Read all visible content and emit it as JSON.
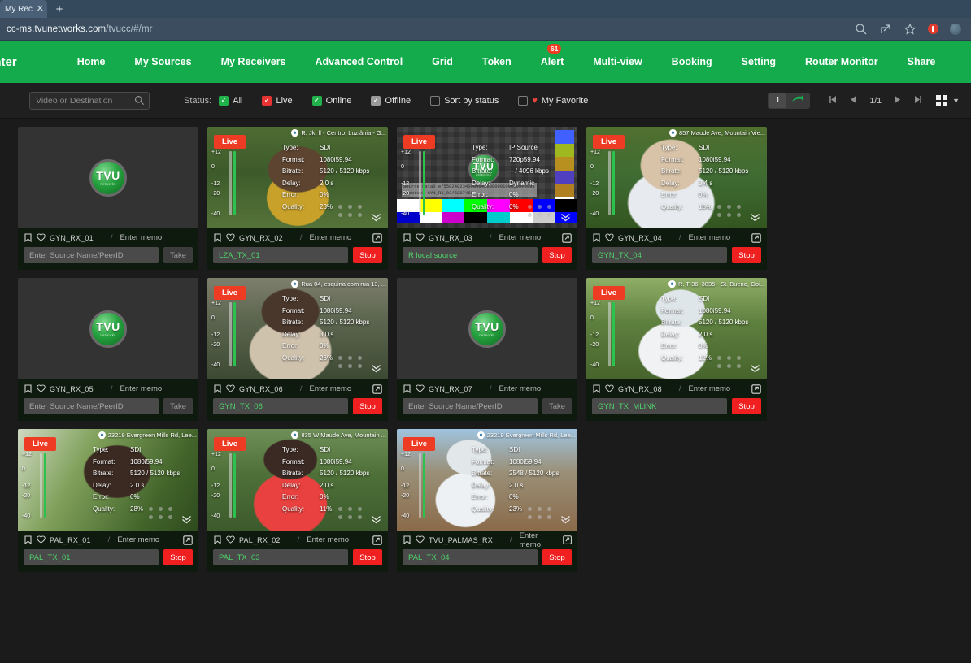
{
  "browser": {
    "tab_title": "My Rece",
    "tab_close": "✕",
    "new_tab": "+",
    "url_main": "cc-ms.tvunetworks.com",
    "url_path": "/tvucc/#/mr"
  },
  "nav": {
    "brand": "enter",
    "items": [
      {
        "label": "Home",
        "badge": null
      },
      {
        "label": "My Sources",
        "badge": null
      },
      {
        "label": "My Receivers",
        "badge": null
      },
      {
        "label": "Advanced Control",
        "badge": null
      },
      {
        "label": "Grid",
        "badge": null
      },
      {
        "label": "Token",
        "badge": null
      },
      {
        "label": "Alert",
        "badge": "61"
      },
      {
        "label": "Multi-view",
        "badge": null
      },
      {
        "label": "Booking",
        "badge": null
      },
      {
        "label": "Setting",
        "badge": null
      },
      {
        "label": "Router Monitor",
        "badge": null
      },
      {
        "label": "Share",
        "badge": null
      }
    ]
  },
  "toolbar": {
    "search_placeholder": "Video or Destination",
    "search_value": "",
    "status_label": "Status:",
    "filters": [
      {
        "label": "All",
        "checked": true,
        "color": "green"
      },
      {
        "label": "Live",
        "checked": true,
        "color": "red"
      },
      {
        "label": "Online",
        "checked": true,
        "color": "green"
      },
      {
        "label": "Offline",
        "checked": true,
        "color": "gray"
      },
      {
        "label": "Sort by status",
        "checked": false,
        "color": "empty"
      },
      {
        "label": "My Favorite",
        "checked": false,
        "color": "empty",
        "heart": true
      }
    ],
    "page_number": "1",
    "page_indicator": "1/1"
  },
  "cards": [
    {
      "rx_name": "GYN_RX_01",
      "memo_placeholder": "Enter memo",
      "status": "offline",
      "source_value": "",
      "source_placeholder": "Enter Source Name/PeerID",
      "action_label": "Take",
      "action_type": "take"
    },
    {
      "rx_name": "GYN_RX_02",
      "memo_placeholder": "Enter memo",
      "status": "live",
      "live_label": "Live",
      "location": "R. Jk, ll - Centro, Luziânia - G...",
      "stats": {
        "Type": "SDI",
        "Format": "1080i59.94",
        "Bitrate": "5120 / 5120 kbps",
        "Delay": "2.0 s",
        "Error": "0%",
        "Quality": "23%"
      },
      "source_value": "LZA_TX_01",
      "source_placeholder": "Enter Source Name/PeerID",
      "action_label": "Stop",
      "action_type": "stop"
    },
    {
      "rx_name": "GYN_RX_03",
      "memo_placeholder": "Enter memo",
      "status": "live-testpattern",
      "live_label": "Live",
      "stats": {
        "Type": "IP Source",
        "Format": "720p59.94",
        "Bitrate": "-- / 4096 kbps",
        "Delay": "Dynamic",
        "Error": "0%",
        "Quality": "0%"
      },
      "overlay_clock": "11:50:5",
      "overlay_source": "Source   Data0  e/55024023400000420000001000C00F0991",
      "overlay_receiver": "Receiver GYN_RX_03/6227460   ",
      "source_value": "R local source",
      "source_placeholder": "Enter Source Name/PeerID",
      "action_label": "Stop",
      "action_type": "stop"
    },
    {
      "rx_name": "GYN_RX_04",
      "memo_placeholder": "Enter memo",
      "status": "live",
      "live_label": "Live",
      "location": "857 Maude Ave, Mountain Vie...",
      "stats": {
        "Type": "SDI",
        "Format": "1080i59.94",
        "Bitrate": "5120 / 5120 kbps",
        "Delay": "3.4 s",
        "Error": "0%",
        "Quality": "18%"
      },
      "source_value": "GYN_TX_04",
      "source_placeholder": "Enter Source Name/PeerID",
      "action_label": "Stop",
      "action_type": "stop"
    },
    {
      "rx_name": "GYN_RX_05",
      "memo_placeholder": "Enter memo",
      "status": "offline",
      "source_value": "",
      "source_placeholder": "Enter Source Name/PeerID",
      "action_label": "Take",
      "action_type": "take"
    },
    {
      "rx_name": "GYN_RX_06",
      "memo_placeholder": "Enter memo",
      "status": "live",
      "live_label": "Live",
      "location": "Rua 04, esquina com rua 13, ...",
      "stats": {
        "Type": "SDI",
        "Format": "1080i59.94",
        "Bitrate": "5120 / 5120 kbps",
        "Delay": "3.0 s",
        "Error": "0%",
        "Quality": "26%"
      },
      "source_value": "GYN_TX_06",
      "source_placeholder": "Enter Source Name/PeerID",
      "action_label": "Stop",
      "action_type": "stop"
    },
    {
      "rx_name": "GYN_RX_07",
      "memo_placeholder": "Enter memo",
      "status": "offline",
      "source_value": "",
      "source_placeholder": "Enter Source Name/PeerID",
      "action_label": "Take",
      "action_type": "take"
    },
    {
      "rx_name": "GYN_RX_08",
      "memo_placeholder": "Enter memo",
      "status": "live",
      "live_label": "Live",
      "location": "R. T-36, 3835 - St. Bueno, Goi...",
      "stats": {
        "Type": "SDI",
        "Format": "1080i59.94",
        "Bitrate": "5120 / 5120 kbps",
        "Delay": "2.0 s",
        "Error": "0%",
        "Quality": "12%"
      },
      "source_value": "GYN_TX_MLINK",
      "source_placeholder": "Enter Source Name/PeerID",
      "action_label": "Stop",
      "action_type": "stop"
    },
    {
      "rx_name": "PAL_RX_01",
      "memo_placeholder": "Enter memo",
      "status": "live",
      "live_label": "Live",
      "location": "23219 Evergreen Mills Rd, Lee...",
      "stats": {
        "Type": "SDI",
        "Format": "1080i59.94",
        "Bitrate": "5120 / 5120 kbps",
        "Delay": "2.0 s",
        "Error": "0%",
        "Quality": "28%"
      },
      "source_value": "PAL_TX_01",
      "source_placeholder": "Enter Source Name/PeerID",
      "action_label": "Stop",
      "action_type": "stop"
    },
    {
      "rx_name": "PAL_RX_02",
      "memo_placeholder": "Enter memo",
      "status": "live",
      "live_label": "Live",
      "location": "835 W Maude Ave, Mountain ...",
      "stats": {
        "Type": "SDI",
        "Format": "1080i59.94",
        "Bitrate": "5120 / 5120 kbps",
        "Delay": "2.0 s",
        "Error": "0%",
        "Quality": "11%"
      },
      "source_value": "PAL_TX_03",
      "source_placeholder": "Enter Source Name/PeerID",
      "action_label": "Stop",
      "action_type": "stop"
    },
    {
      "rx_name": "TVU_PALMAS_RX",
      "memo_placeholder": "Enter memo",
      "status": "live",
      "live_label": "Live",
      "location": "23219 Evergreen Mills Rd, Lee...",
      "stats": {
        "Type": "SDI",
        "Format": "1080i59.94",
        "Bitrate": "2548 / 5120 kbps",
        "Delay": "2.0 s",
        "Error": "0%",
        "Quality": "23%"
      },
      "bitrate_warn": true,
      "source_value": "PAL_TX_04",
      "source_placeholder": "Enter Source Name/PeerID",
      "action_label": "Stop",
      "action_type": "stop"
    }
  ],
  "icons": {
    "bookmark": "bookmark-icon",
    "heart": "heart-icon",
    "external": "external-link-icon",
    "search": "search-icon",
    "pin": "location-pin-icon",
    "chevron_double_down": "chevron-double-down-icon"
  },
  "colors": {
    "brand_green": "#13ab4b",
    "live_red": "#ee3b24",
    "stop_red": "#f02020",
    "badge_red": "#ef3d23",
    "source_green": "#4fd36a"
  },
  "meter_labels": [
    "+12",
    "0",
    "-12",
    "-20",
    "-40"
  ]
}
